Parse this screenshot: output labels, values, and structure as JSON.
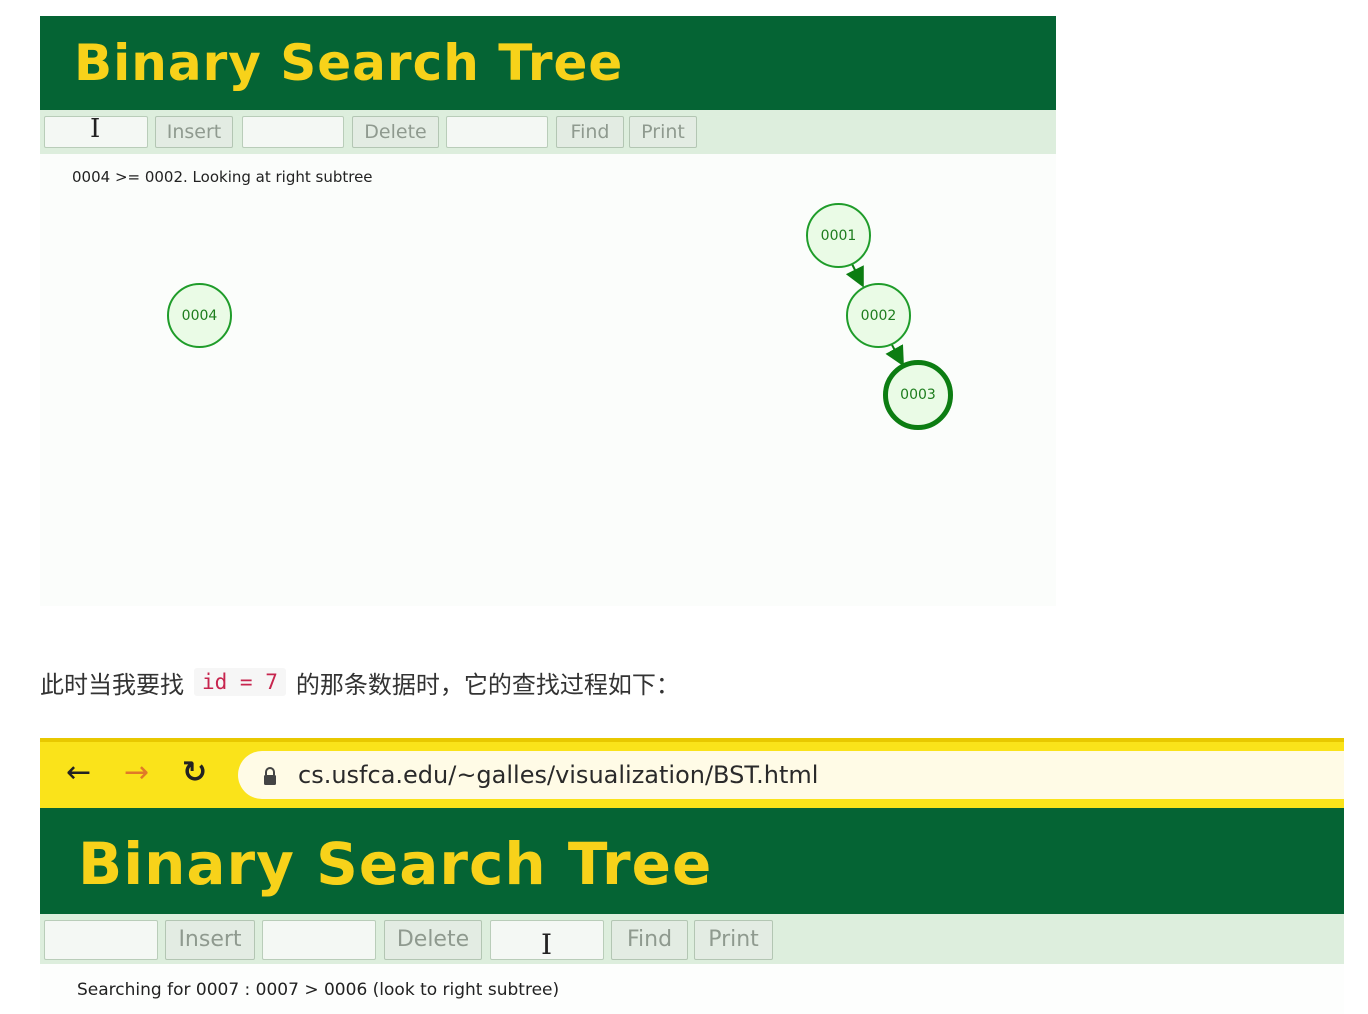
{
  "top_app": {
    "title": "Binary Search Tree",
    "buttons": {
      "insert": "Insert",
      "delete": "Delete",
      "find": "Find",
      "print": "Print"
    },
    "status": "0004 >= 0002.  Looking at right subtree",
    "floating_node": "0004",
    "tree_nodes": [
      "0001",
      "0002",
      "0003"
    ]
  },
  "caption": {
    "before": "此时当我要找",
    "code": "id = 7",
    "after": "的那条数据时，它的查找过程如下："
  },
  "browser": {
    "back_icon": "←",
    "forward_icon": "→",
    "reload_icon": "↻",
    "lock_icon": "lock-icon",
    "url": "cs.usfca.edu/~galles/visualization/BST.html"
  },
  "bottom_app": {
    "title": "Binary Search Tree",
    "buttons": {
      "insert": "Insert",
      "delete": "Delete",
      "find": "Find",
      "print": "Print"
    },
    "status": "Searching for 0007 : 0007 > 0006 (look to right subtree)"
  },
  "colors": {
    "header_bg": "#056434",
    "title_yellow": "#f7d21a",
    "toolbar_bg": "#ddeedd",
    "node_border": "#1f9c2a",
    "node_fill": "#eafbe6",
    "browser_yellow": "#fae31a"
  }
}
